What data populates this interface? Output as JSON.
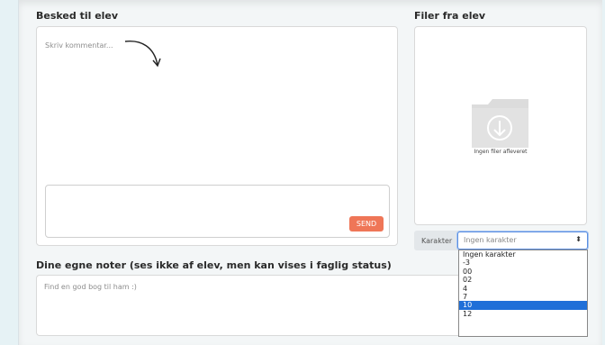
{
  "message": {
    "heading": "Besked til elev",
    "comment_placeholder": "Skriv kommentar...",
    "send_label": "SEND"
  },
  "files": {
    "heading": "Filer fra elev",
    "empty_text": "Ingen filer afleveret"
  },
  "grade": {
    "label": "Karakter",
    "selected": "Ingen karakter",
    "options": [
      "Ingen karakter",
      "-3",
      "00",
      "02",
      "4",
      "7",
      "10",
      "12"
    ],
    "highlighted": "10"
  },
  "notes": {
    "heading": "Dine egne noter (ses ikke af elev, men kan vises i faglig status)",
    "value": "Find en god bog til ham :)"
  },
  "colors": {
    "send": "#ef7657",
    "highlight": "#1f6fd8"
  }
}
